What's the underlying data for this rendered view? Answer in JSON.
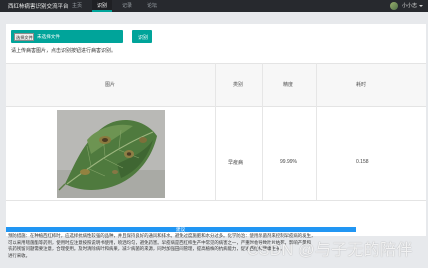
{
  "header": {
    "brand": "西红柿病害识别交流平台",
    "nav": [
      {
        "label": "主页",
        "active": false
      },
      {
        "label": "识别",
        "active": true
      },
      {
        "label": "记录",
        "active": false
      },
      {
        "label": "论坛",
        "active": false
      }
    ],
    "user_name": "小小志",
    "accent_color": "#00a49a"
  },
  "upload": {
    "choose_file_label": "选择文件",
    "file_status": "未选择文件",
    "detect_label": "识别",
    "hint": "请上传病害图片，点击识别按钮进行病害识别。"
  },
  "table": {
    "columns": [
      "图片",
      "类别",
      "精度",
      "耗时"
    ],
    "rows": [
      {
        "image": "tomato-leaf-early-blight",
        "category": "早疫病",
        "accuracy": "99.99%",
        "time": "0.158"
      }
    ]
  },
  "suggestion": {
    "title": "建议",
    "lines": [
      "预防措施：在种植西红柿时，应选择抗病性较强的品种，并且保持良好的通风和排水。避免过度施肥和水分过多。化学防治：使用杀菌剂来控制早疫病的发生，",
      "可以采用嘧菌酯等药剂，使用时应注意按照说明书使用，喷洒均匀，避免药害。早疫病是西红柿生产中常见的病害之一，严重时会导致叶片枯死，影响产量和",
      "农药残留问题需要注意，合理使用。及时清除病叶和病果，减少病菌的来源，同时加强田间管理，提高植株的抗病能力，促进西红柿健康生长。",
      "进行采收。"
    ]
  },
  "watermark": "CSDN @与子无的陪伴"
}
